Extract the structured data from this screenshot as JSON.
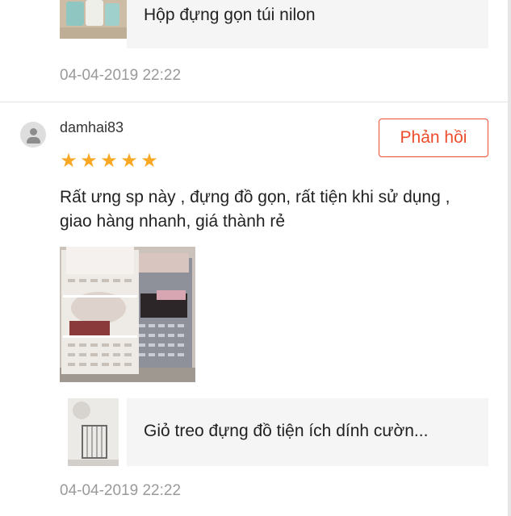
{
  "previous_review": {
    "product_name": "Hộp đựng gọn túi nilon",
    "date": "04-04-2019 22:22"
  },
  "review": {
    "username": "damhai83",
    "reply_label": "Phản hồi",
    "rating": 5,
    "stars": [
      "★",
      "★",
      "★",
      "★",
      "★"
    ],
    "text": "Rất ưng sp này , đựng đồ gọn, rất tiện khi sử dụng , giao hàng nhanh, giá thành rẻ",
    "product_name": "Giỏ treo đựng đồ tiện ích dính cườn...",
    "date": "04-04-2019 22:22"
  },
  "colors": {
    "accent": "#ee4d2d",
    "star": "#f9a825",
    "muted_text": "#9a9a9a",
    "product_bg": "#f5f5f5"
  },
  "icons": {
    "avatar": "user-placeholder-icon",
    "star": "star-icon"
  }
}
